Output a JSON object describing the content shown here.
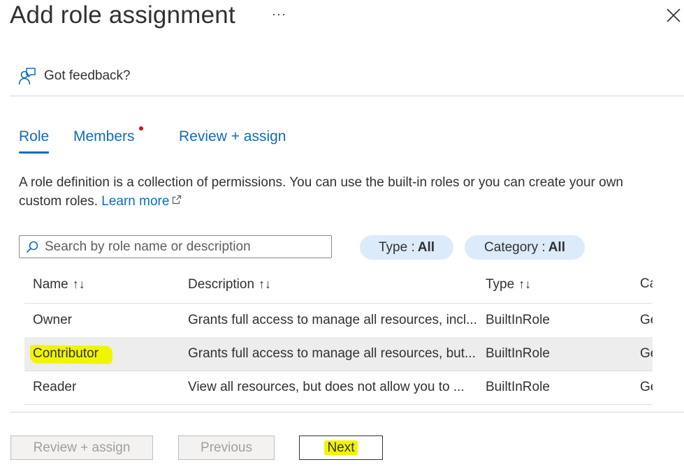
{
  "header": {
    "title": "Add role assignment",
    "more_label": "···"
  },
  "feedback": {
    "label": "Got feedback?"
  },
  "tabs": [
    {
      "label": "Role"
    },
    {
      "label": "Members"
    },
    {
      "label": "Review + assign"
    }
  ],
  "description": {
    "text": "A role definition is a collection of permissions. You can use the built-in roles or you can create your own custom roles.",
    "link_label": "Learn more"
  },
  "search": {
    "placeholder": "Search by role name or description",
    "value": ""
  },
  "filters": {
    "type": {
      "label": "Type :",
      "value": "All"
    },
    "category": {
      "label": "Category :",
      "value": "All"
    }
  },
  "table": {
    "columns": [
      {
        "label": "Name"
      },
      {
        "label": "Description"
      },
      {
        "label": "Type"
      },
      {
        "label": "Ca"
      }
    ],
    "rows": [
      {
        "name": "Owner",
        "description": "Grants full access to manage all resources, incl...",
        "type": "BuiltInRole",
        "category": "Ge"
      },
      {
        "name": "Contributor",
        "description": "Grants full access to manage all resources, but...",
        "type": "BuiltInRole",
        "category": "Ge"
      },
      {
        "name": "Reader",
        "description": "View all resources, but does not allow you to ...",
        "type": "BuiltInRole",
        "category": "Ge"
      }
    ],
    "selected_row": "Contributor"
  },
  "footer": {
    "review_assign_label": "Review + assign",
    "previous_label": "Previous",
    "next_label": "Next"
  },
  "colors": {
    "accent": "#0f6cbd",
    "filter_pill": "#dcebfa",
    "highlight": "#f0f500",
    "notification_dot": "#e00b1c",
    "selected_row": "#ededed"
  },
  "icons": {
    "feedback": "feedback-person-icon",
    "close": "close-icon",
    "search": "search-icon",
    "sort": "sort-arrows-icon",
    "external_link": "external-link-icon"
  }
}
